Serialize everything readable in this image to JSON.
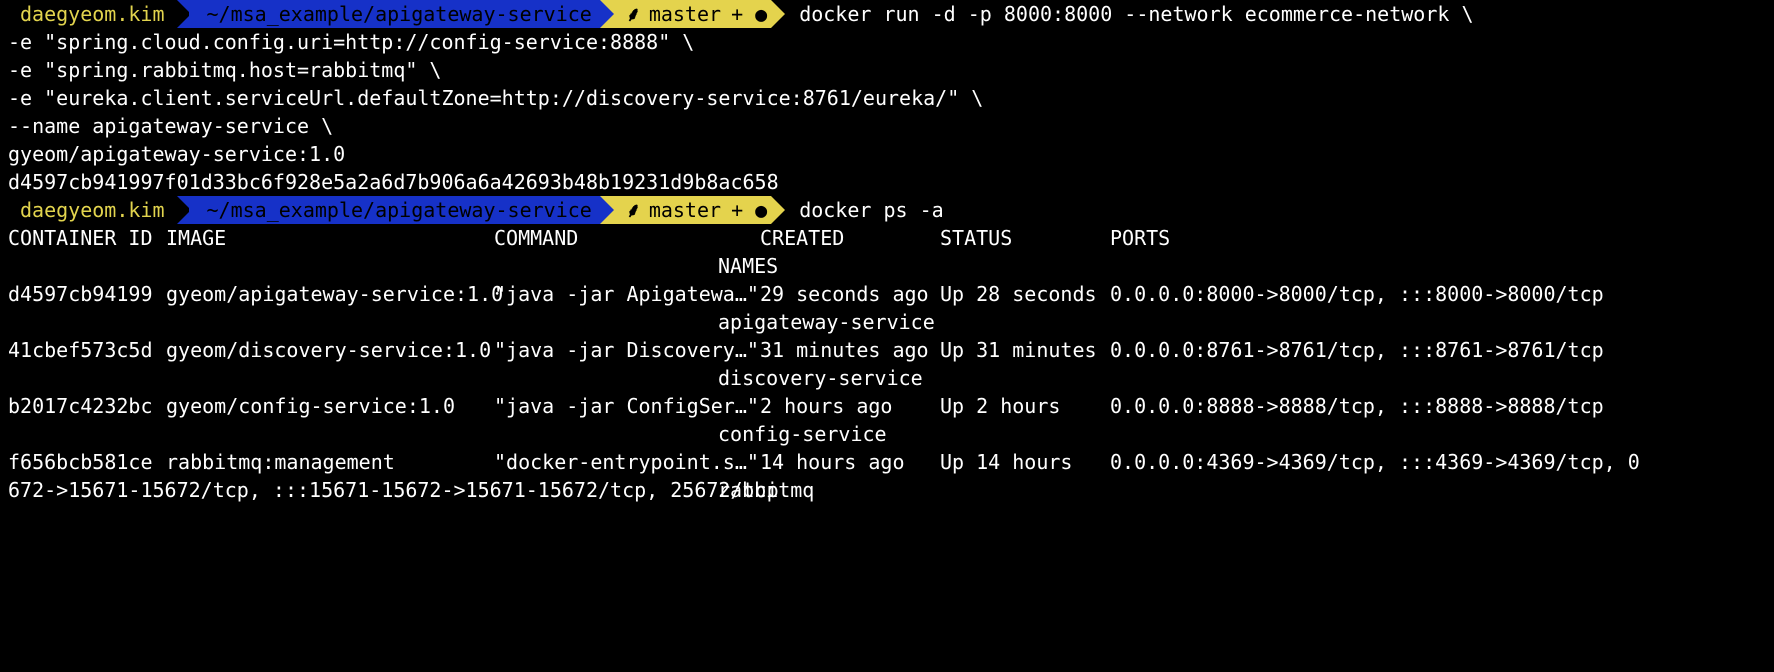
{
  "prompt": {
    "user": "daegyeom.kim",
    "path": "~/msa_example/apigateway-service",
    "git_branch": "master",
    "git_status": "+ ●"
  },
  "commands": {
    "docker_run": [
      "docker run -d -p 8000:8000 --network ecommerce-network \\",
      "-e \"spring.cloud.config.uri=http://config-service:8888\" \\",
      "-e \"spring.rabbitmq.host=rabbitmq\" \\",
      "-e \"eureka.client.serviceUrl.defaultZone=http://discovery-service:8761/eureka/\" \\",
      "--name apigateway-service \\",
      "gyeom/apigateway-service:1.0"
    ],
    "docker_run_output": "d4597cb941997f01d33bc6f928e5a2a6d7b906a6a42693b48b19231d9b8ac658",
    "docker_ps": "docker ps -a"
  },
  "table": {
    "headers": {
      "container_id": "CONTAINER ID",
      "image": "IMAGE",
      "command": "COMMAND",
      "created": "CREATED",
      "status": "STATUS",
      "ports": "PORTS",
      "names": "NAMES"
    },
    "rows": [
      {
        "container_id": "d4597cb94199",
        "image": "gyeom/apigateway-service:1.0",
        "command": "\"java -jar Apigatewa…\"",
        "created": "29 seconds ago",
        "status": "Up 28 seconds",
        "ports": "0.0.0.0:8000->8000/tcp, :::8000->8000/tcp",
        "names": "apigateway-service"
      },
      {
        "container_id": "41cbef573c5d",
        "image": "gyeom/discovery-service:1.0",
        "command": "\"java -jar Discovery…\"",
        "created": "31 minutes ago",
        "status": "Up 31 minutes",
        "ports": "0.0.0.0:8761->8761/tcp, :::8761->8761/tcp",
        "names": "discovery-service"
      },
      {
        "container_id": "b2017c4232bc",
        "image": "gyeom/config-service:1.0",
        "command": "\"java -jar ConfigSer…\"",
        "created": "2 hours ago",
        "status": "Up 2 hours",
        "ports": "0.0.0.0:8888->8888/tcp, :::8888->8888/tcp",
        "names": "config-service"
      },
      {
        "container_id": "f656bcb581ce",
        "image": "rabbitmq:management",
        "command": "\"docker-entrypoint.s…\"",
        "created": "14 hours ago",
        "status": "Up 14 hours",
        "ports": "0.0.0.0:4369->4369/tcp, :::4369->4369/tcp, 0",
        "ports_wrap": "672->15671-15672/tcp, :::15671-15672->15671-15672/tcp, 25672/tcp",
        "names": "rabbitmq"
      }
    ]
  },
  "colors": {
    "background": "#000000",
    "text": "#ffffff",
    "prompt_user": "#e2d44e",
    "prompt_path_bg": "#1631c8",
    "prompt_git_bg": "#e4d34d"
  }
}
